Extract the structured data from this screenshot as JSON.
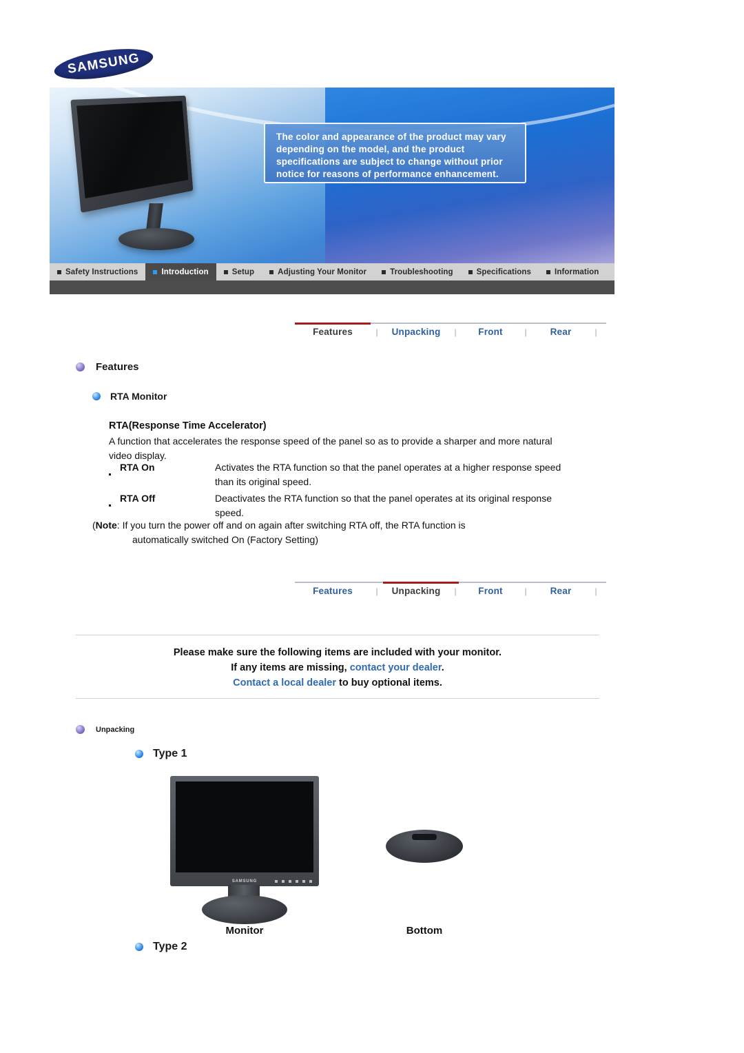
{
  "brand": {
    "logo_text": "SAMSUNG"
  },
  "hero": {
    "notice": "The color and appearance of the product may vary depending on the model, and the product specifications are subject to change without prior notice for reasons of performance enhancement."
  },
  "main_nav": {
    "items": [
      {
        "label": "Safety Instructions",
        "active": false
      },
      {
        "label": "Introduction",
        "active": true
      },
      {
        "label": "Setup",
        "active": false
      },
      {
        "label": "Adjusting Your Monitor",
        "active": false
      },
      {
        "label": "Troubleshooting",
        "active": false
      },
      {
        "label": "Specifications",
        "active": false
      },
      {
        "label": "Information",
        "active": false
      }
    ]
  },
  "subtabs_features": {
    "active": "Features",
    "items": [
      "Features",
      "Unpacking",
      "Front",
      "Rear"
    ],
    "separator": "|"
  },
  "subtabs_unpacking": {
    "active": "Unpacking",
    "items": [
      "Features",
      "Unpacking",
      "Front",
      "Rear"
    ],
    "separator": "|"
  },
  "features_section": {
    "heading": "Features",
    "subheading": "RTA Monitor",
    "title": "RTA(Response Time Accelerator)",
    "description": "A function that accelerates the response speed of the panel so as to provide a sharper and more natural video display.",
    "definitions": [
      {
        "term": "RTA On",
        "desc": "Activates the RTA function so that the panel operates at a higher response speed than its original speed."
      },
      {
        "term": "RTA Off",
        "desc": "Deactivates the RTA function so that the panel operates at its original response speed."
      }
    ],
    "note_open": "(",
    "note_label": "Note",
    "note_body": ": If you turn the power off and on again after switching RTA off, the RTA function is",
    "note_body2": "automatically switched On (Factory Setting)"
  },
  "unpacking_section": {
    "include_line1": "Please make sure the following items are included with your monitor.",
    "include_line2_pre": "If any items are missing, ",
    "include_line2_link": "contact your dealer",
    "include_line2_post": ".",
    "include_line3_link": "Contact a local dealer",
    "include_line3_post": " to buy optional items.",
    "heading": "Unpacking",
    "type1_label": "Type 1",
    "type2_label": "Type 2",
    "caption_monitor": "Monitor",
    "caption_bottom": "Bottom",
    "monitor_brand": "SAMSUNG"
  },
  "colors": {
    "accent_red": "#a61c1c",
    "link_blue": "#2f6ab5",
    "nav_active_bg": "#4a4a4a",
    "nav_bg": "#d2d2d2",
    "brand_navy": "#1f2f7a"
  }
}
